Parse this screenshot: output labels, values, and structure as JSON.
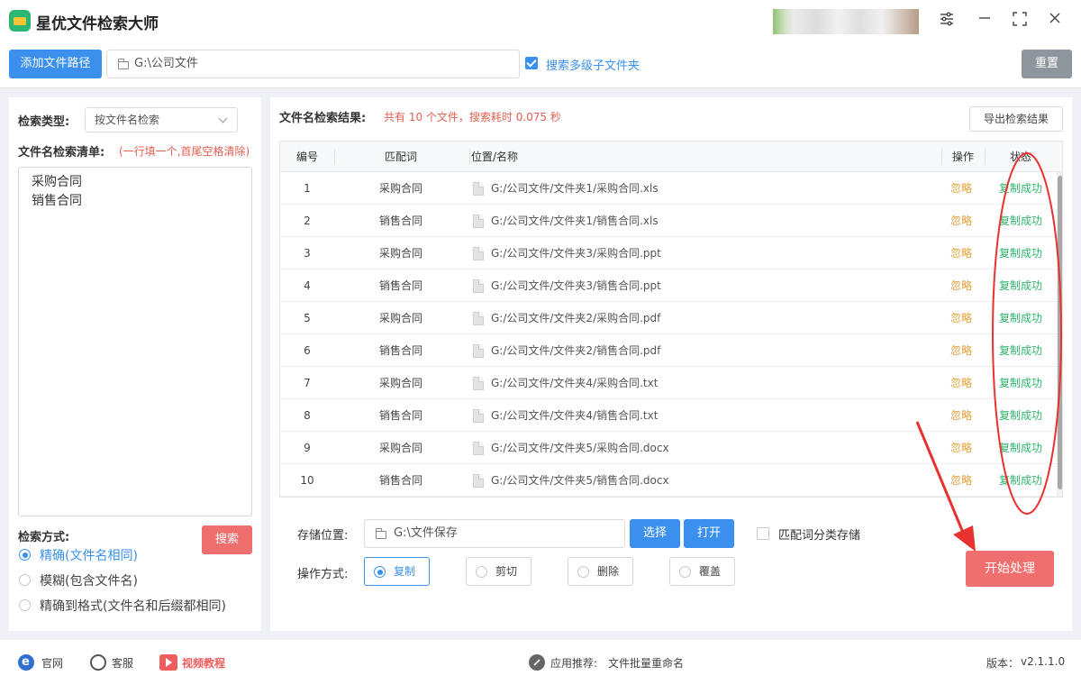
{
  "app": {
    "title": "星优文件检索大师"
  },
  "toolbar": {
    "add_path_label": "添加文件路径",
    "path_value": "G:\\公司文件",
    "include_subfolders_label": "搜索多级子文件夹",
    "include_subfolders_checked": true,
    "reset_label": "重置"
  },
  "left": {
    "search_type_label": "检索类型:",
    "search_type_value": "按文件名检索",
    "list_label": "文件名检索清单:",
    "list_hint": "(一行填一个,首尾空格清除)",
    "list_lines": [
      "采购合同",
      "销售合同"
    ],
    "search_button": "搜索",
    "method_label": "检索方式:",
    "methods": [
      {
        "label": "精确(文件名相同)",
        "selected": true
      },
      {
        "label": "模糊(包含文件名)",
        "selected": false
      },
      {
        "label": "精确到格式(文件名和后缀都相同)",
        "selected": false
      }
    ]
  },
  "results": {
    "label": "文件名检索结果:",
    "summary": "共有 10 个文件，搜索耗时 0.075 秒",
    "export_button": "导出检索结果",
    "columns": {
      "no": "编号",
      "keyword": "匹配词",
      "path": "位置/名称",
      "op": "操作",
      "status": "状态"
    },
    "rows": [
      {
        "no": "1",
        "keyword": "采购合同",
        "path": "G:/公司文件/文件夹1/采购合同.xls",
        "op": "忽略",
        "status": "复制成功"
      },
      {
        "no": "2",
        "keyword": "销售合同",
        "path": "G:/公司文件/文件夹1/销售合同.xls",
        "op": "忽略",
        "status": "复制成功"
      },
      {
        "no": "3",
        "keyword": "采购合同",
        "path": "G:/公司文件/文件夹3/采购合同.ppt",
        "op": "忽略",
        "status": "复制成功"
      },
      {
        "no": "4",
        "keyword": "销售合同",
        "path": "G:/公司文件/文件夹3/销售合同.ppt",
        "op": "忽略",
        "status": "复制成功"
      },
      {
        "no": "5",
        "keyword": "采购合同",
        "path": "G:/公司文件/文件夹2/采购合同.pdf",
        "op": "忽略",
        "status": "复制成功"
      },
      {
        "no": "6",
        "keyword": "销售合同",
        "path": "G:/公司文件/文件夹2/销售合同.pdf",
        "op": "忽略",
        "status": "复制成功"
      },
      {
        "no": "7",
        "keyword": "采购合同",
        "path": "G:/公司文件/文件夹4/采购合同.txt",
        "op": "忽略",
        "status": "复制成功"
      },
      {
        "no": "8",
        "keyword": "销售合同",
        "path": "G:/公司文件/文件夹4/销售合同.txt",
        "op": "忽略",
        "status": "复制成功"
      },
      {
        "no": "9",
        "keyword": "采购合同",
        "path": "G:/公司文件/文件夹5/采购合同.docx",
        "op": "忽略",
        "status": "复制成功"
      },
      {
        "no": "10",
        "keyword": "销售合同",
        "path": "G:/公司文件/文件夹5/销售合同.docx",
        "op": "忽略",
        "status": "复制成功"
      }
    ]
  },
  "storage": {
    "label": "存储位置:",
    "value": "G:\\文件保存",
    "choose_button": "选择",
    "open_button": "打开",
    "classify_label": "匹配词分类存储",
    "classify_checked": false
  },
  "operation": {
    "label": "操作方式:",
    "options": [
      {
        "label": "复制",
        "selected": true
      },
      {
        "label": "剪切",
        "selected": false
      },
      {
        "label": "删除",
        "selected": false
      },
      {
        "label": "覆盖",
        "selected": false
      }
    ],
    "start_button": "开始处理"
  },
  "footer": {
    "website": "官网",
    "support": "客服",
    "video": "视频教程",
    "recommend_label": "应用推荐:",
    "recommend_app": "文件批量重命名",
    "version_label": "版本：",
    "version": "v2.1.1.0"
  },
  "colors": {
    "primary_blue": "#3a90ec",
    "red_button": "#ef6f6f",
    "success_green": "#2fb36a",
    "ignore_orange": "#e5a03a",
    "annotation_red": "#e8322f"
  }
}
